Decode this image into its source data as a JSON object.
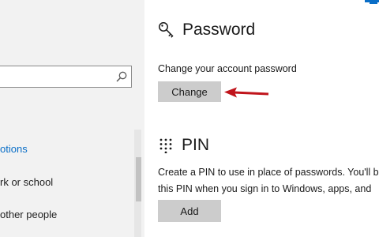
{
  "sidebar": {
    "search": {
      "value": "",
      "placeholder": ""
    },
    "items": [
      {
        "label": "otions",
        "active": true
      },
      {
        "label": "rk or school",
        "active": false
      },
      {
        "label": "other people",
        "active": false
      }
    ]
  },
  "password": {
    "title": "Password",
    "description": "Change your account password",
    "button_label": "Change"
  },
  "pin": {
    "title": "PIN",
    "line1": "Create a PIN to use in place of passwords. You'll b",
    "line2": "this PIN when you sign in to Windows, apps, and",
    "button_label": "Add"
  },
  "colors": {
    "accent": "#0a6ec7",
    "arrow": "#c0141b",
    "sidebar_bg": "#f2f2f2",
    "button_bg": "#cccccc"
  }
}
